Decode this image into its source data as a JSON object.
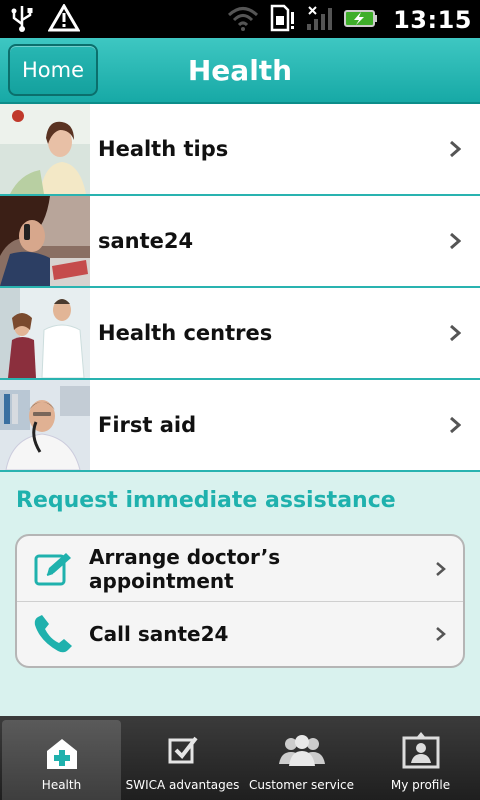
{
  "status_bar": {
    "time": "13:15"
  },
  "header": {
    "home_label": "Home",
    "title": "Health"
  },
  "menu": [
    {
      "label": "Health tips",
      "icon": "woman-portrait-photo"
    },
    {
      "label": "sante24",
      "icon": "woman-on-phone-photo"
    },
    {
      "label": "Health centres",
      "icon": "doctor-consultation-photo"
    },
    {
      "label": "First aid",
      "icon": "doctor-on-phone-photo"
    }
  ],
  "assistance": {
    "title": "Request immediate assistance",
    "items": [
      {
        "label": "Arrange doctor’s appointment",
        "icon": "edit-icon"
      },
      {
        "label": "Call sante24",
        "icon": "phone-icon"
      }
    ]
  },
  "tabs": [
    {
      "label": "Health",
      "icon": "health-cross-icon",
      "active": true
    },
    {
      "label": "SWICA advantages",
      "icon": "checkbox-icon",
      "active": false
    },
    {
      "label": "Customer service",
      "icon": "people-icon",
      "active": false
    },
    {
      "label": "My profile",
      "icon": "profile-frame-icon",
      "active": false
    }
  ],
  "colors": {
    "accent": "#1fb1ad",
    "header": "#17a9a6",
    "panel_bg": "#d9f2ee"
  }
}
